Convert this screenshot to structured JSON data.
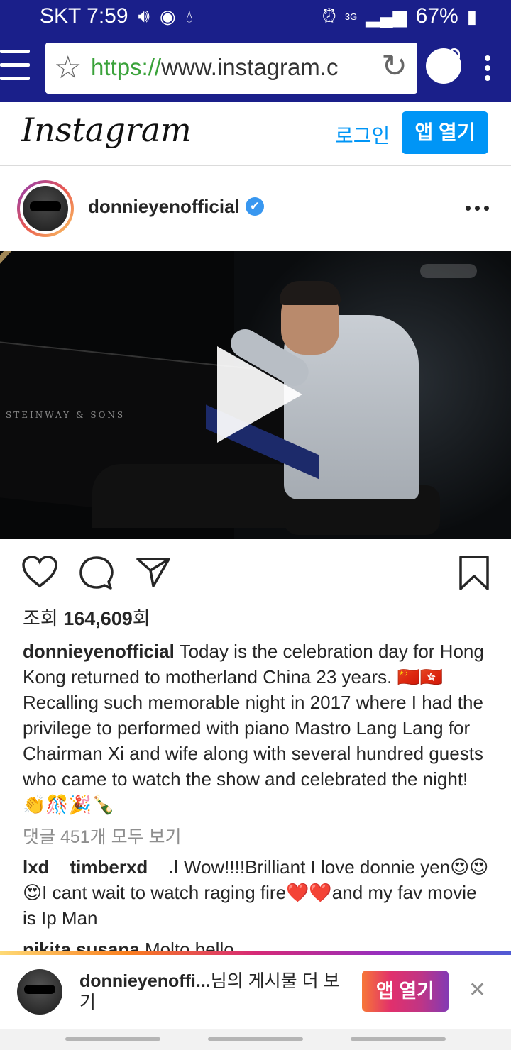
{
  "status_bar": {
    "carrier_time": "SKT 7:59",
    "network": "3G",
    "battery": "67%"
  },
  "browser": {
    "url_scheme": "https://",
    "url_rest": "www.instagram.c"
  },
  "header": {
    "logo": "Instagram",
    "login_label": "로그인",
    "open_app_label": "앱 열기"
  },
  "post": {
    "username": "donnieyenofficial",
    "verified_mark": "✔",
    "media_brand": "STEINWAY & SONS",
    "views_prefix": "조회 ",
    "views_count": "164,609",
    "views_suffix": "회",
    "caption_user": "donnieyenofficial",
    "caption_text": " Today is the celebration day for Hong Kong returned to motherland China 23 years. 🇨🇳🇭🇰Recalling such memorable night in 2017 where I had the privilege to performed with piano Mastro Lang Lang for Chairman Xi and wife along with several hundred guests who came to watch the show and celebrated the night! 👏🎊🎉🍾",
    "view_all_comments": "댓글 451개 모두 보기",
    "comments": [
      {
        "user": "lxd__timberxd__.l",
        "text": " Wow!!!!Brilliant I love donnie yen😍😍😍I cant wait to watch raging fire❤️❤️and my fav movie is Ip Man"
      },
      {
        "user": "nikita.susana",
        "text": " Molto bello"
      }
    ]
  },
  "banner": {
    "user": "donnieyenoffi...",
    "text": "님의 게시물 더 보기",
    "button_label": "앱 열기",
    "close": "✕"
  },
  "colors": {
    "status_bar": "#1a1f8a",
    "link_blue": "#0095f6",
    "url_green": "#3aa23a"
  }
}
